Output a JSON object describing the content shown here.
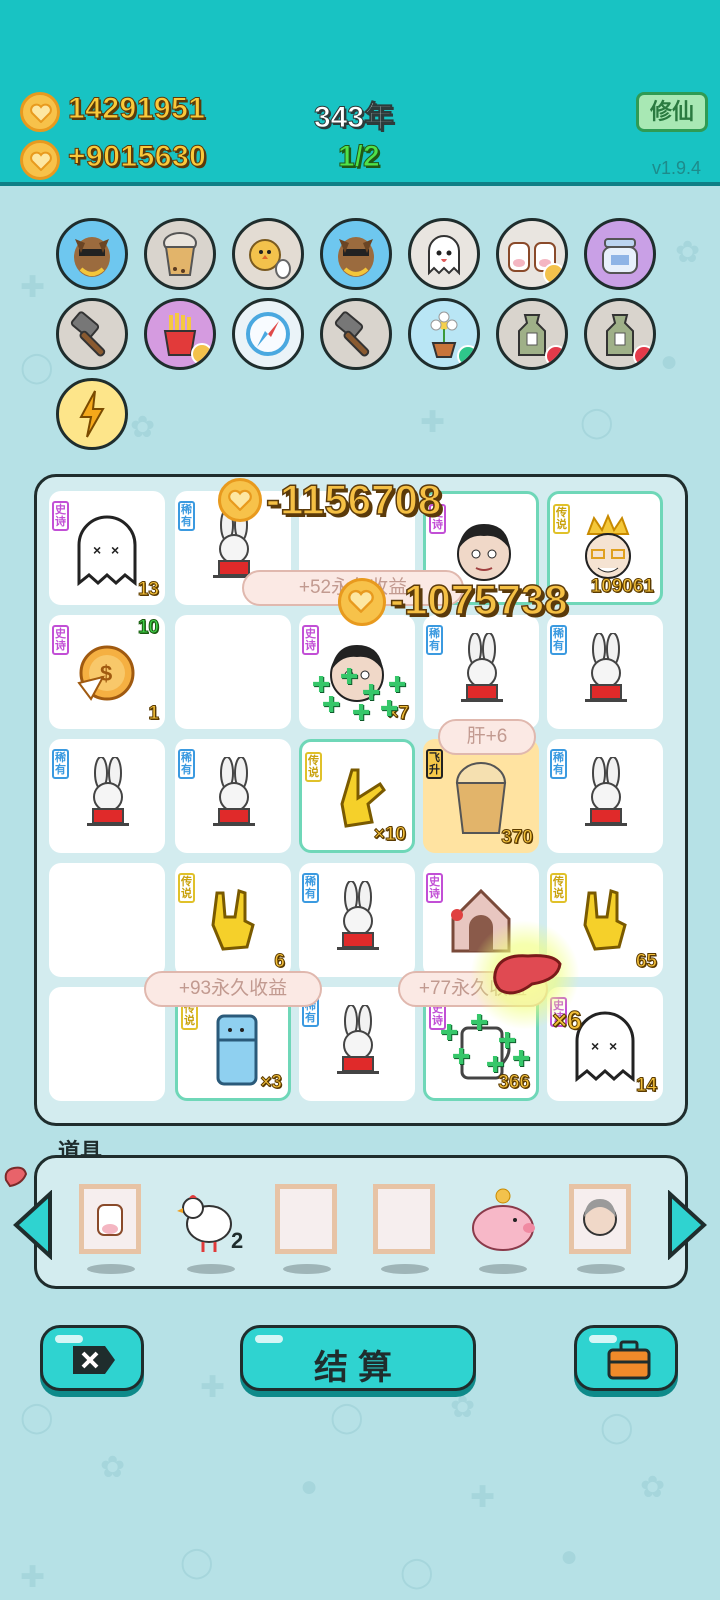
{
  "header": {
    "coins": "14291951",
    "income": "+9015630",
    "year": "343年",
    "page": "1/2",
    "xiuxian_label": "修仙",
    "version": "v1.9.4"
  },
  "board": {
    "floats": [
      "-1156708",
      "-1075738"
    ],
    "pills": [
      "+52永久收益",
      "+93永久收益",
      "+77永久收益"
    ],
    "pill_short": [
      "+52永久收益",
      "肝+6"
    ],
    "cells": [
      {
        "tag": "史诗",
        "num": "13"
      },
      {
        "tag": "稀有",
        "num": ""
      },
      {
        "tag": "",
        "num": ""
      },
      {
        "tag": "史诗",
        "num": ""
      },
      {
        "tag": "传说",
        "num": "109061"
      },
      {
        "tag": "史诗",
        "num": "1",
        "extra": "10"
      },
      {
        "tag": "",
        "num": ""
      },
      {
        "tag": "史诗",
        "num": "×7"
      },
      {
        "tag": "稀有",
        "num": ""
      },
      {
        "tag": "稀有",
        "num": ""
      },
      {
        "tag": "稀有",
        "num": ""
      },
      {
        "tag": "稀有",
        "num": ""
      },
      {
        "tag": "传说",
        "num": "×10"
      },
      {
        "tag": "飞升",
        "num": "370",
        "bubble": "肝+6"
      },
      {
        "tag": "稀有",
        "num": ""
      },
      {
        "tag": "",
        "num": ""
      },
      {
        "tag": "传说",
        "num": "6"
      },
      {
        "tag": "稀有",
        "num": ""
      },
      {
        "tag": "史诗",
        "num": ""
      },
      {
        "tag": "传说",
        "num": "65"
      },
      {
        "tag": "",
        "num": ""
      },
      {
        "tag": "传说",
        "num": "×3"
      },
      {
        "tag": "稀有",
        "num": ""
      },
      {
        "tag": "史诗",
        "num": "366"
      },
      {
        "tag": "史诗",
        "num": "14"
      }
    ],
    "liver_mult": "×6"
  },
  "items": {
    "label": "道具",
    "chicken_count": "2"
  },
  "buttons": {
    "settle": "结算"
  },
  "colors": {
    "header_bg": "#18c3c3",
    "page_bg": "#b6e1e6",
    "board_bg": "#d3ecef",
    "gold_text": "#f9c93a",
    "button_bg": "#2fd3d0"
  }
}
